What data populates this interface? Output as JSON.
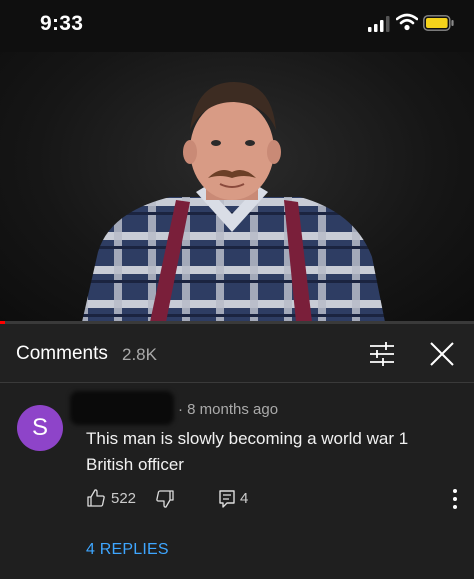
{
  "status_bar": {
    "time": "9:33",
    "icons": [
      "signal-icon",
      "wifi-icon",
      "battery-icon"
    ],
    "battery_color": "#f5d31b"
  },
  "video": {
    "progress_fraction": 0.01,
    "progress_color": "#ff0000"
  },
  "comments_panel": {
    "title": "Comments",
    "count": "2.8K",
    "icons": [
      "filter-icon",
      "close-icon"
    ]
  },
  "comment": {
    "avatar_letter": "S",
    "avatar_color": "#8e44c9",
    "time": "· 8 months ago",
    "text": "This man is slowly becoming a world war 1 British officer",
    "likes": "522",
    "replies_count": "4",
    "replies_link": "4 REPLIES",
    "link_color": "#3ea6ff",
    "icons": [
      "thumbs-up-icon",
      "thumbs-down-icon",
      "reply-icon",
      "more-vert-icon"
    ]
  }
}
